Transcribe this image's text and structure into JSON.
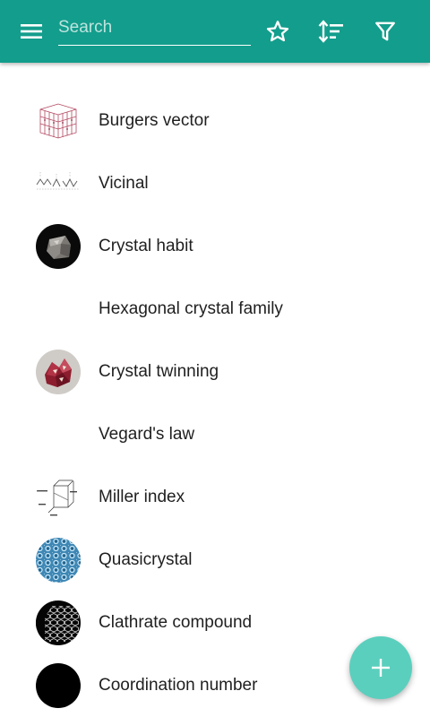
{
  "toolbar": {
    "menu_icon": "menu-icon",
    "search_placeholder": "Search",
    "search_value": "",
    "favorites_icon": "star-outline-icon",
    "sort_icon": "sort-icon",
    "filter_icon": "filter-icon",
    "color": "#139d8c"
  },
  "articles": [
    {
      "title": "Burgers vector",
      "thumbnail": "burgers-vector-thumbnail"
    },
    {
      "title": "Vicinal",
      "thumbnail": "vicinal-thumbnail"
    },
    {
      "title": "Crystal habit",
      "thumbnail": "crystal-habit-thumbnail"
    },
    {
      "title": "Hexagonal crystal family",
      "thumbnail": ""
    },
    {
      "title": "Crystal twinning",
      "thumbnail": "crystal-twinning-thumbnail"
    },
    {
      "title": "Vegard's law",
      "thumbnail": ""
    },
    {
      "title": "Miller index",
      "thumbnail": "miller-index-thumbnail"
    },
    {
      "title": "Quasicrystal",
      "thumbnail": "quasicrystal-thumbnail"
    },
    {
      "title": "Clathrate compound",
      "thumbnail": "clathrate-compound-thumbnail"
    },
    {
      "title": "Coordination number",
      "thumbnail": "coordination-number-thumbnail"
    }
  ],
  "fab": {
    "icon": "plus-icon",
    "color": "#5bcfbd"
  }
}
